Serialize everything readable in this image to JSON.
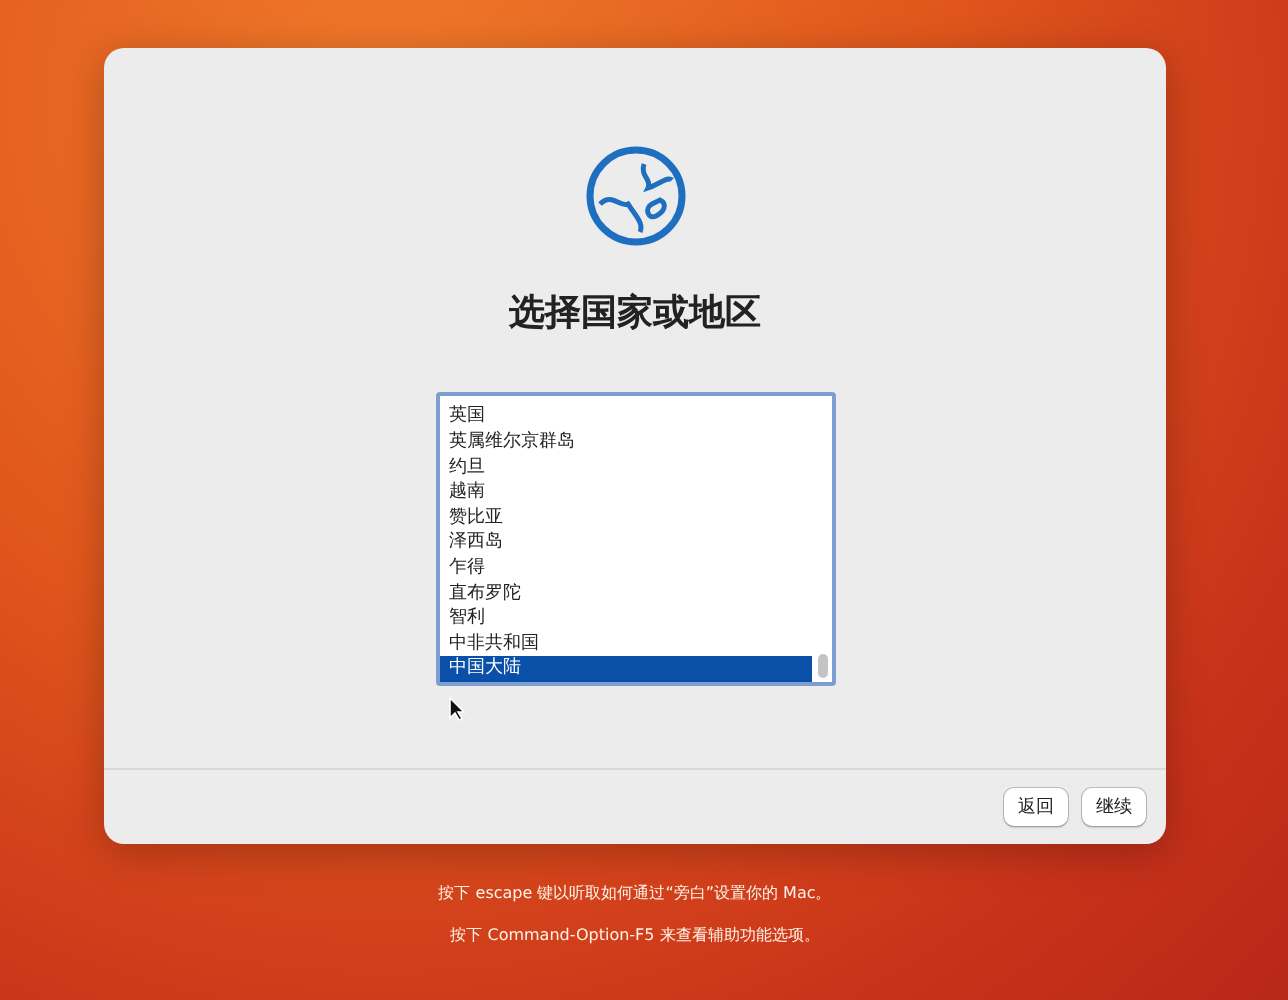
{
  "title": "选择国家或地区",
  "countries": [
    {
      "label": "英国",
      "selected": false
    },
    {
      "label": "英属维尔京群岛",
      "selected": false
    },
    {
      "label": "约旦",
      "selected": false
    },
    {
      "label": "越南",
      "selected": false
    },
    {
      "label": "赞比亚",
      "selected": false
    },
    {
      "label": "泽西岛",
      "selected": false
    },
    {
      "label": "乍得",
      "selected": false
    },
    {
      "label": "直布罗陀",
      "selected": false
    },
    {
      "label": "智利",
      "selected": false
    },
    {
      "label": "中非共和国",
      "selected": false
    },
    {
      "label": "中国大陆",
      "selected": true
    }
  ],
  "buttons": [
    "返回",
    "继续"
  ],
  "hints": [
    "按下 escape 键以听取如何通过“旁白”设置你的 Mac。",
    "按下 Command-Option-F5 来查看辅助功能选项。"
  ]
}
